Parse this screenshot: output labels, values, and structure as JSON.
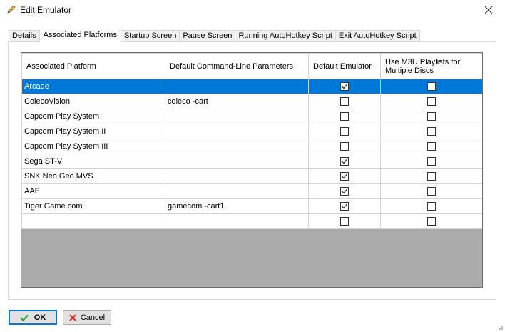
{
  "window": {
    "title": "Edit Emulator"
  },
  "tabs": [
    {
      "label": "Details"
    },
    {
      "label": "Associated Platforms"
    },
    {
      "label": "Startup Screen"
    },
    {
      "label": "Pause Screen"
    },
    {
      "label": "Running AutoHotkey Script"
    },
    {
      "label": "Exit AutoHotkey Script"
    }
  ],
  "active_tab_index": 1,
  "grid": {
    "columns": [
      "Associated Platform",
      "Default Command-Line Parameters",
      "Default Emulator",
      "Use M3U Playlists for Multiple Discs"
    ],
    "rows": [
      {
        "platform": "Arcade",
        "params": "",
        "default": true,
        "m3u": false,
        "selected": true
      },
      {
        "platform": "ColecoVision",
        "params": "coleco -cart",
        "default": false,
        "m3u": false,
        "selected": false
      },
      {
        "platform": "Capcom Play System",
        "params": "",
        "default": false,
        "m3u": false,
        "selected": false
      },
      {
        "platform": "Capcom Play System II",
        "params": "",
        "default": false,
        "m3u": false,
        "selected": false
      },
      {
        "platform": "Capcom Play System III",
        "params": "",
        "default": false,
        "m3u": false,
        "selected": false
      },
      {
        "platform": "Sega ST-V",
        "params": "",
        "default": true,
        "m3u": false,
        "selected": false
      },
      {
        "platform": "SNK Neo Geo MVS",
        "params": "",
        "default": true,
        "m3u": false,
        "selected": false
      },
      {
        "platform": "AAE",
        "params": "",
        "default": true,
        "m3u": false,
        "selected": false
      },
      {
        "platform": "Tiger Game.com",
        "params": "gamecom -cart1",
        "default": true,
        "m3u": false,
        "selected": false
      },
      {
        "platform": "",
        "params": "",
        "default": false,
        "m3u": false,
        "selected": false
      }
    ]
  },
  "buttons": {
    "ok_label": "OK",
    "cancel_label": "Cancel"
  },
  "colors": {
    "selection": "#0078d7",
    "ok_check": "#2e9e3a",
    "cancel_x": "#d9342b"
  }
}
